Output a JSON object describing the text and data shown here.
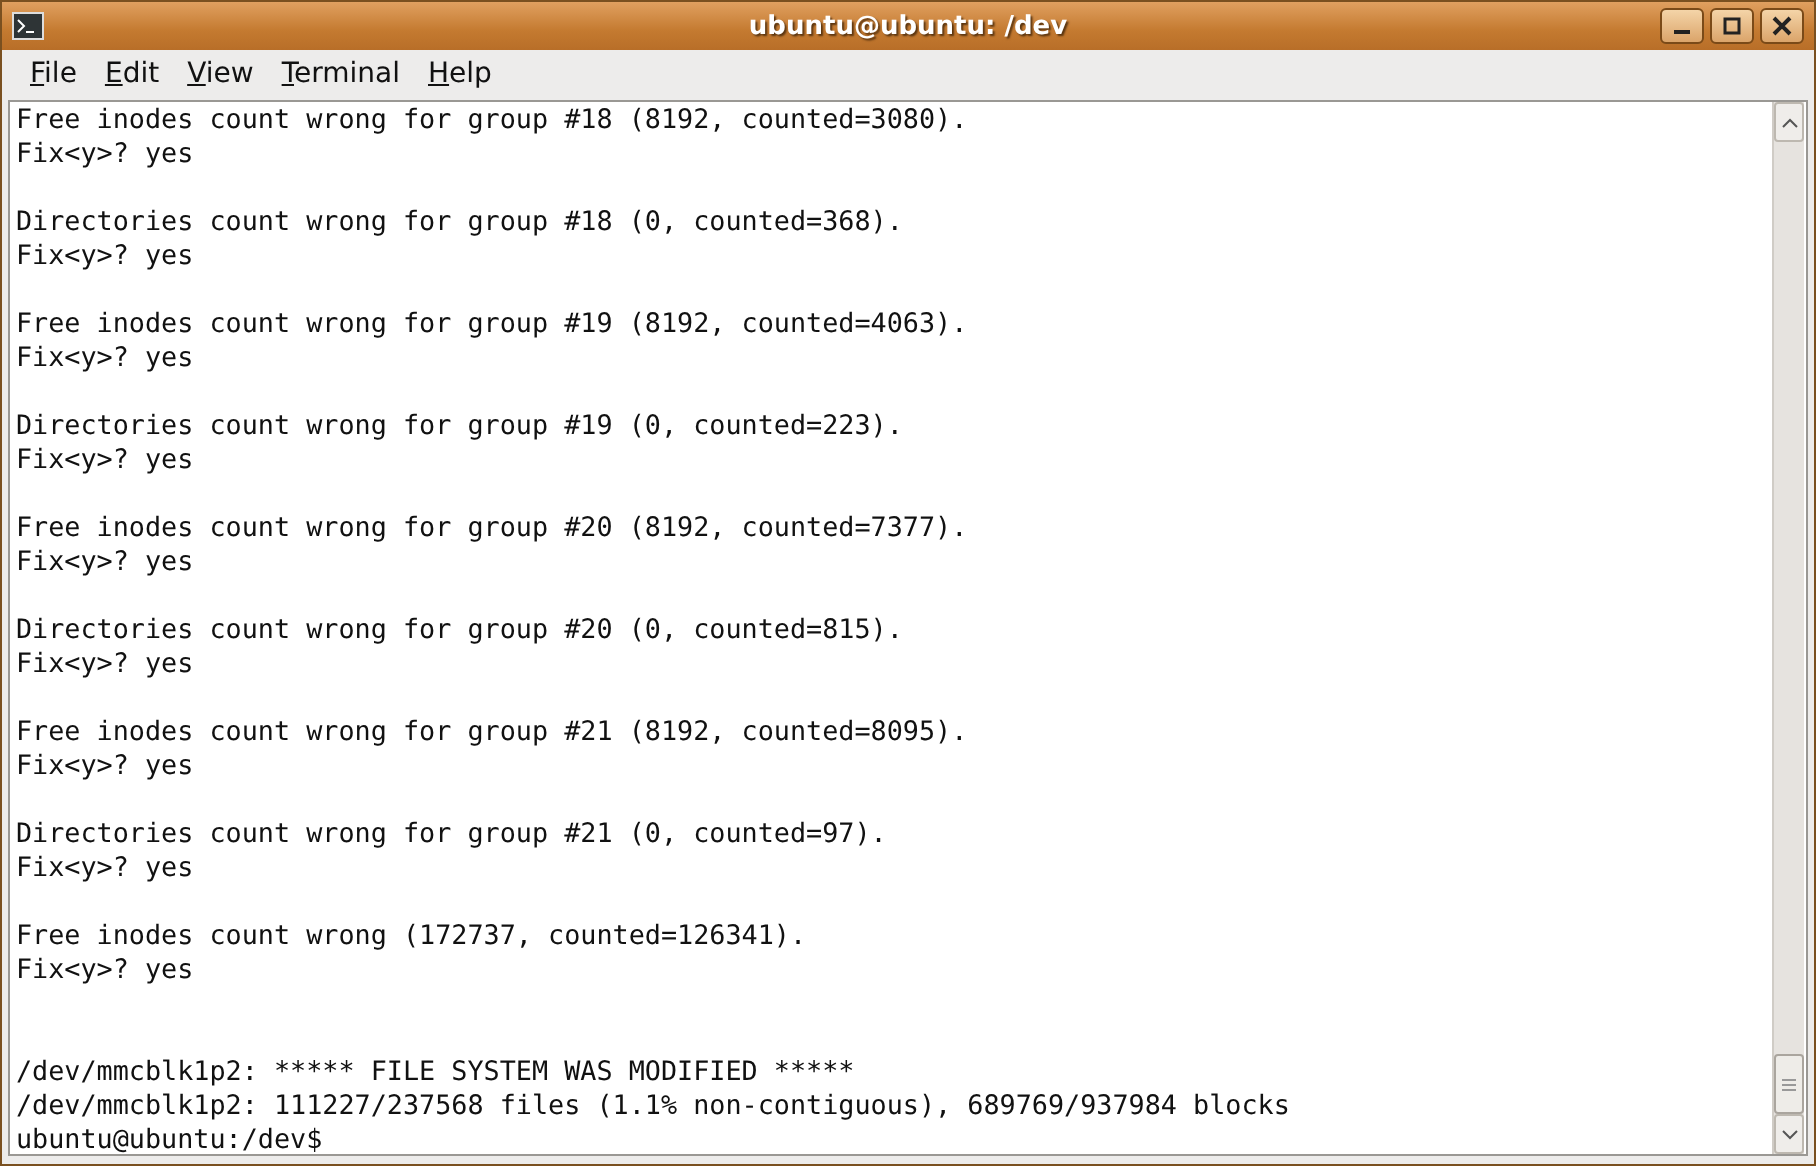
{
  "window": {
    "title": "ubuntu@ubuntu: /dev"
  },
  "menu": [
    "File",
    "Edit",
    "View",
    "Terminal",
    "Help"
  ],
  "terminal": {
    "blocks": [
      {
        "kind": "entry",
        "lines": [
          "Free inodes count wrong for group #18 (8192, counted=3080).",
          "Fix<y>? yes"
        ]
      },
      {
        "kind": "entry",
        "lines": [
          "Directories count wrong for group #18 (0, counted=368).",
          "Fix<y>? yes"
        ]
      },
      {
        "kind": "entry",
        "lines": [
          "Free inodes count wrong for group #19 (8192, counted=4063).",
          "Fix<y>? yes"
        ]
      },
      {
        "kind": "entry",
        "lines": [
          "Directories count wrong for group #19 (0, counted=223).",
          "Fix<y>? yes"
        ]
      },
      {
        "kind": "entry",
        "lines": [
          "Free inodes count wrong for group #20 (8192, counted=7377).",
          "Fix<y>? yes"
        ]
      },
      {
        "kind": "entry",
        "lines": [
          "Directories count wrong for group #20 (0, counted=815).",
          "Fix<y>? yes"
        ]
      },
      {
        "kind": "entry",
        "lines": [
          "Free inodes count wrong for group #21 (8192, counted=8095).",
          "Fix<y>? yes"
        ]
      },
      {
        "kind": "entry",
        "lines": [
          "Directories count wrong for group #21 (0, counted=97).",
          "Fix<y>? yes"
        ]
      },
      {
        "kind": "entry",
        "lines": [
          "Free inodes count wrong (172737, counted=126341).",
          "Fix<y>? yes"
        ]
      },
      {
        "kind": "summary",
        "lines": [
          "/dev/mmcblk1p2: ***** FILE SYSTEM WAS MODIFIED *****",
          "/dev/mmcblk1p2: 111227/237568 files (1.1% non-contiguous), 689769/937984 blocks",
          "ubuntu@ubuntu:/dev$"
        ]
      }
    ]
  }
}
